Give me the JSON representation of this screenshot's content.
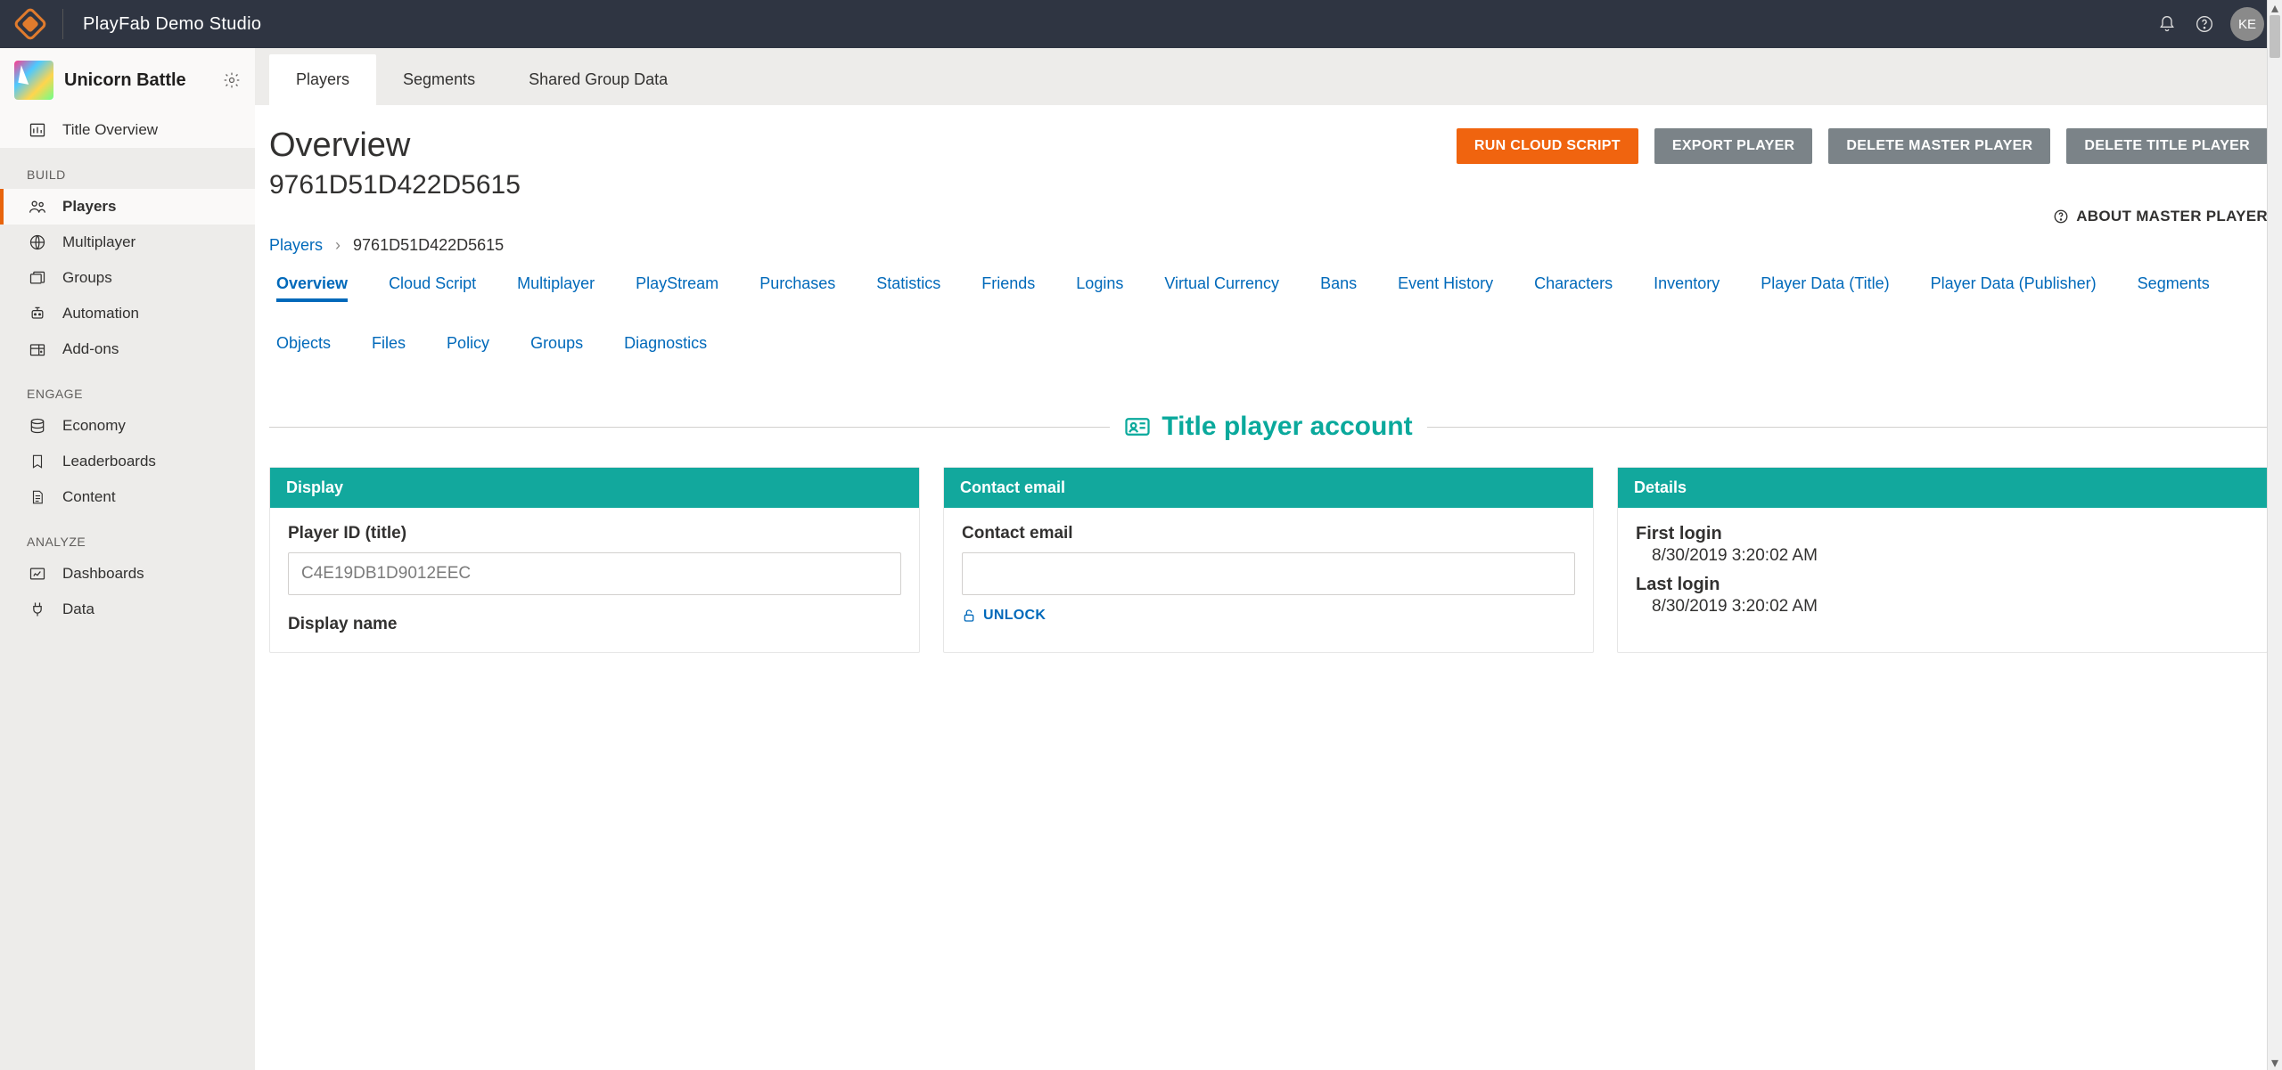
{
  "topbar": {
    "studio_name": "PlayFab Demo Studio",
    "avatar_initials": "KE"
  },
  "sidebar": {
    "game_title": "Unicorn Battle",
    "items_top": [
      {
        "label": "Title Overview",
        "icon": "chart"
      }
    ],
    "sections": [
      {
        "label": "BUILD",
        "items": [
          {
            "label": "Players",
            "icon": "players",
            "active": true
          },
          {
            "label": "Multiplayer",
            "icon": "globe"
          },
          {
            "label": "Groups",
            "icon": "stack"
          },
          {
            "label": "Automation",
            "icon": "robot"
          },
          {
            "label": "Add-ons",
            "icon": "addon"
          }
        ]
      },
      {
        "label": "ENGAGE",
        "items": [
          {
            "label": "Economy",
            "icon": "coins"
          },
          {
            "label": "Leaderboards",
            "icon": "bookmark"
          },
          {
            "label": "Content",
            "icon": "doc"
          }
        ]
      },
      {
        "label": "ANALYZE",
        "items": [
          {
            "label": "Dashboards",
            "icon": "dashboard"
          },
          {
            "label": "Data",
            "icon": "plug"
          }
        ]
      }
    ]
  },
  "tabs": [
    {
      "label": "Players",
      "active": true
    },
    {
      "label": "Segments"
    },
    {
      "label": "Shared Group Data"
    }
  ],
  "page": {
    "title": "Overview",
    "player_id_master": "9761D51D422D5615",
    "buttons": {
      "run_cs": "RUN CLOUD SCRIPT",
      "export": "EXPORT PLAYER",
      "delete_master": "DELETE MASTER PLAYER",
      "delete_title": "DELETE TITLE PLAYER"
    },
    "about_link": "ABOUT MASTER PLAYER",
    "breadcrumb": {
      "root": "Players",
      "current": "9761D51D422D5615"
    },
    "subtabs": [
      "Overview",
      "Cloud Script",
      "Multiplayer",
      "PlayStream",
      "Purchases",
      "Statistics",
      "Friends",
      "Logins",
      "Virtual Currency",
      "Bans",
      "Event History",
      "Characters",
      "Inventory",
      "Player Data (Title)",
      "Player Data (Publisher)",
      "Segments",
      "Objects",
      "Files",
      "Policy",
      "Groups",
      "Diagnostics"
    ],
    "section_title": "Title player account",
    "cards": {
      "display": {
        "title": "Display",
        "player_id_label": "Player ID (title)",
        "player_id_value": "C4E19DB1D9012EEC",
        "display_name_label": "Display name"
      },
      "contact": {
        "title": "Contact email",
        "field_label": "Contact email",
        "field_value": "",
        "unlock": "UNLOCK"
      },
      "details": {
        "title": "Details",
        "first_login_label": "First login",
        "first_login_value": "8/30/2019 3:20:02 AM",
        "last_login_label": "Last login",
        "last_login_value": "8/30/2019 3:20:02 AM"
      }
    }
  }
}
